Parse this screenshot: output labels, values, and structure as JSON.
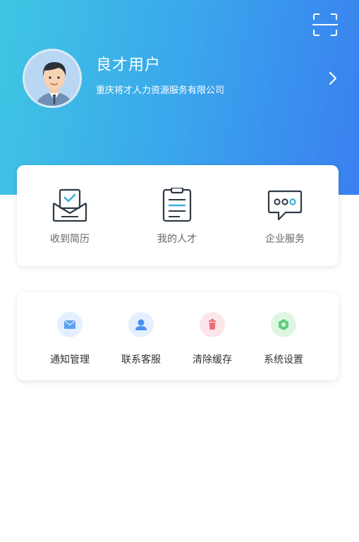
{
  "profile": {
    "name": "良才用户",
    "company": "重庆将才人力资源服务有限公司"
  },
  "main_menu": [
    {
      "label": "收到简历",
      "icon": "resume-inbox-icon"
    },
    {
      "label": "我的人才",
      "icon": "clipboard-icon"
    },
    {
      "label": "企业服务",
      "icon": "chat-bubble-icon"
    }
  ],
  "settings_menu": [
    {
      "label": "通知管理",
      "icon": "mail-icon",
      "color": "#5aa0f0"
    },
    {
      "label": "联系客服",
      "icon": "user-icon",
      "color": "#4a8ef0"
    },
    {
      "label": "清除缓存",
      "icon": "trash-icon",
      "color": "#f0697a"
    },
    {
      "label": "系统设置",
      "icon": "gear-icon",
      "color": "#5ccf7a"
    }
  ],
  "colors": {
    "header_gradient": [
      "#3fc6e3",
      "#3a7ff0"
    ],
    "icon_stroke": "#2f3a45",
    "accent": "#3ab0d8"
  }
}
